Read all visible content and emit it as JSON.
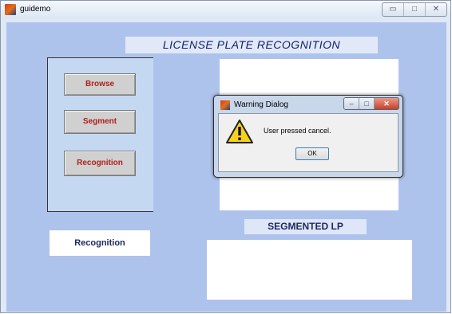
{
  "window": {
    "title": "guidemo",
    "controls": {
      "minimize": "▭",
      "maximize": "□",
      "close": "✕"
    }
  },
  "app": {
    "heading": "LICENSE PLATE RECOGNITION",
    "buttons": {
      "browse": "Browse",
      "segment": "Segment",
      "recognition": "Recognition"
    },
    "result_text": "Recognition",
    "segmented_label": "SEGMENTED LP"
  },
  "dialog": {
    "title": "Warning Dialog",
    "message": "User pressed cancel.",
    "ok_label": "OK",
    "controls": {
      "minimize": "–",
      "maximize": "□",
      "close": "✕"
    }
  },
  "colors": {
    "panel_bg": "#aec3ec",
    "button_text": "#b0201a",
    "heading_text": "#10206a"
  }
}
